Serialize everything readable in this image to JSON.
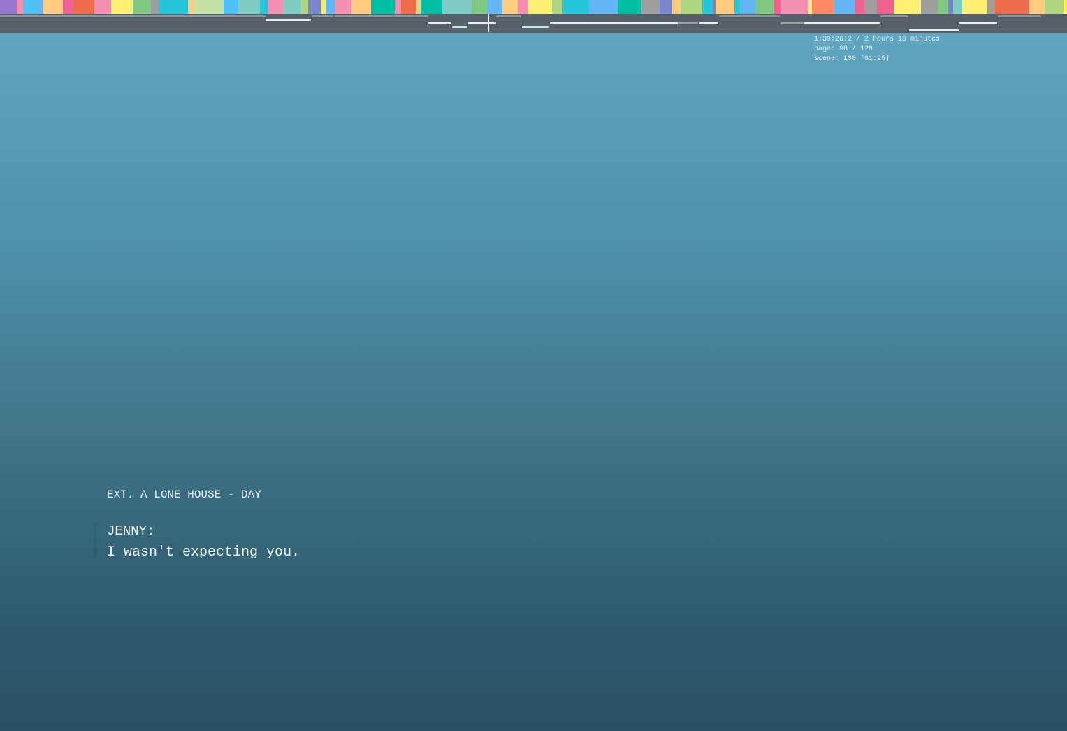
{
  "timeline": {
    "scene_colors": [
      "#9e9e9e",
      "#ef6c4a",
      "#fff176",
      "#c5e1a5",
      "#f48fb1",
      "#80cbc4",
      "#7986cb",
      "#ffcc80",
      "#81c784",
      "#4fc3f7",
      "#9575cd",
      "#00bfa5",
      "#ff8a65",
      "#aed581",
      "#f06292",
      "#64b5f6",
      "#ffee58",
      "#26c6da"
    ],
    "playhead_label": "playhead"
  },
  "info": {
    "time": "1:39:26:2 / 2 hours 10 minutes",
    "page": "page: 98 / 128",
    "scene": "scene: 130 [01:25]"
  },
  "script": {
    "scene_heading": "EXT. A LONE HOUSE - DAY",
    "character": "JENNY:",
    "dialogue": "I wasn't expecting you."
  }
}
